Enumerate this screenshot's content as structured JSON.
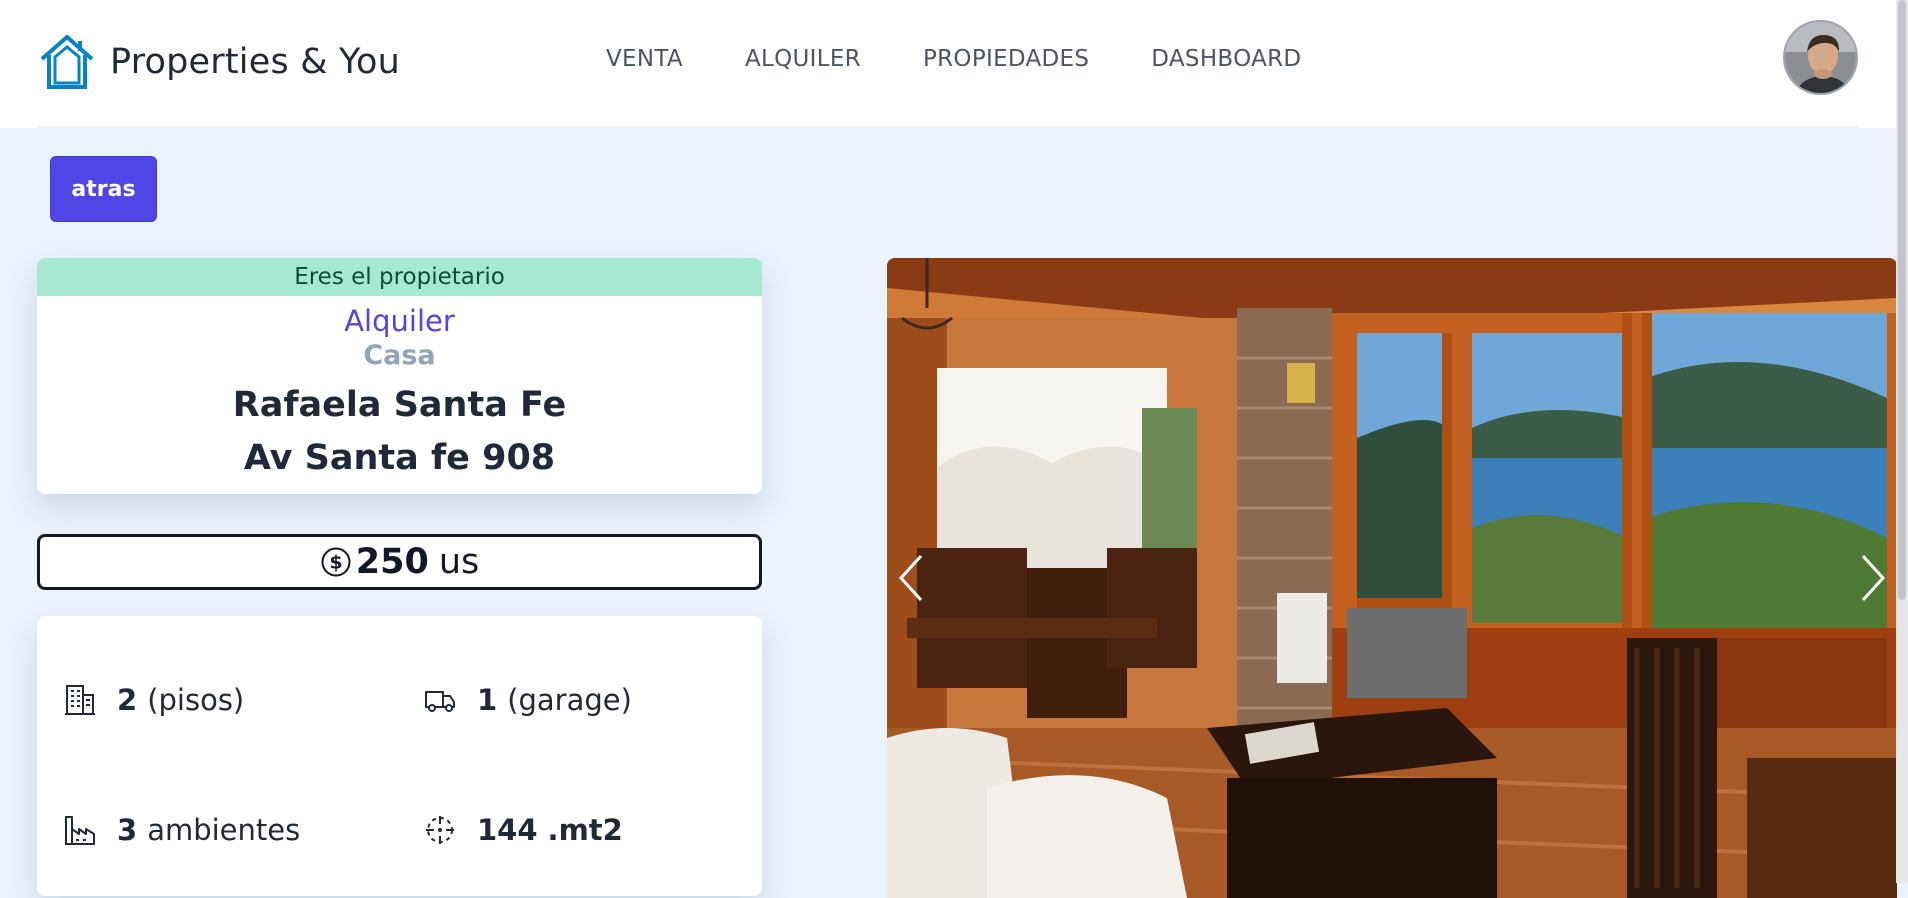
{
  "brand": {
    "name": "Properties & You",
    "logo_icon": "house-outline-icon",
    "accent": "#0284c7"
  },
  "nav": {
    "links": [
      "VENTA",
      "ALQUILER",
      "PROPIEDADES",
      "DASHBOARD"
    ]
  },
  "user": {
    "avatar_icon": "user-avatar"
  },
  "actions": {
    "back_label": "atras",
    "back_color": "#4f46e5"
  },
  "property": {
    "owner_banner": "Eres el propietario",
    "operation": "Alquiler",
    "type": "Casa",
    "city": "Rafaela Santa Fe",
    "address": "Av Santa fe 908",
    "price": {
      "icon": "dollar-circle-icon",
      "value": "250",
      "currency": "us"
    },
    "features": {
      "floors": {
        "icon": "building-icon",
        "value": "2",
        "label": "(pisos)"
      },
      "garage": {
        "icon": "truck-icon",
        "value": "1",
        "label": "(garage)"
      },
      "rooms": {
        "icon": "factory-icon",
        "value": "3",
        "label": "ambientes"
      },
      "area": {
        "icon": "area-dashed-icon",
        "value": "144",
        "label": ".mt2"
      }
    }
  },
  "gallery": {
    "prev_icon": "chevron-left-icon",
    "next_icon": "chevron-right-icon"
  },
  "colors": {
    "owner_banner_bg": "#a7e9d0",
    "page_bg": "#ebf3fd",
    "operation_color": "#4f46e5"
  }
}
